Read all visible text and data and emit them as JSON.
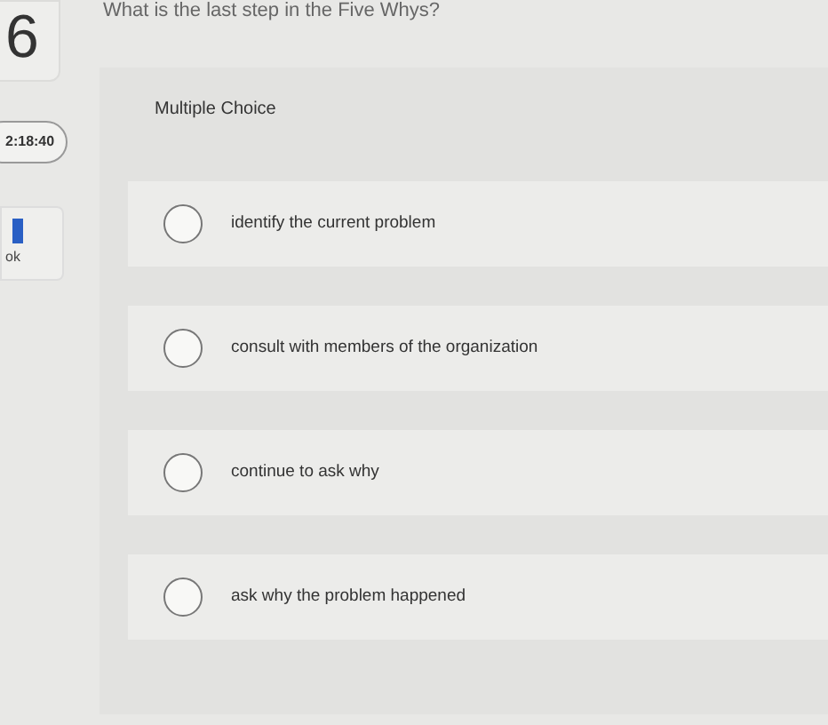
{
  "question_number": "6",
  "timer": "2:18:40",
  "ebook_link": {
    "label": "ok"
  },
  "question": "What is the last step in the Five Whys?",
  "question_type": "Multiple Choice",
  "options": [
    {
      "label": "identify the current problem",
      "selected": false
    },
    {
      "label": "consult with members of the organization",
      "selected": false
    },
    {
      "label": "continue to ask why",
      "selected": false
    },
    {
      "label": "ask why the problem happened",
      "selected": false
    }
  ]
}
